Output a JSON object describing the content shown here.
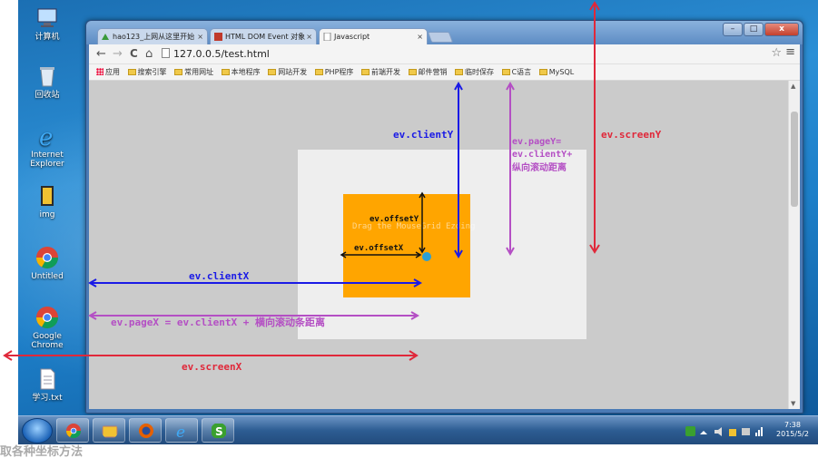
{
  "desktop": {
    "icons": [
      {
        "label": "计算机",
        "icon": "computer-icon"
      },
      {
        "label": "回收站",
        "icon": "recycle-bin-icon"
      },
      {
        "label": "Internet Explorer",
        "icon": "internet-explorer-icon"
      },
      {
        "label": "img",
        "icon": "folder-icon"
      },
      {
        "label": "Untitled",
        "icon": "chrome-icon"
      },
      {
        "label": "Google Chrome",
        "icon": "chrome-icon"
      },
      {
        "label": "学习.txt",
        "icon": "text-file-icon"
      }
    ]
  },
  "browser": {
    "tabs": [
      {
        "label": "hao123_上网从这里开始",
        "icon": "hao123-icon"
      },
      {
        "label": "HTML DOM Event 对象",
        "icon": "w3school-icon"
      },
      {
        "label": "Javascript",
        "icon": "page-icon"
      }
    ],
    "tab_close": "×",
    "nav": {
      "back": "←",
      "forward": "→",
      "reload": "C",
      "home": "⌂"
    },
    "url": "127.0.0.5/test.html",
    "star": "☆",
    "menu": "≡",
    "window_controls": {
      "minimize": "–",
      "maximize": "□",
      "close": "x"
    },
    "bookmarks": [
      "应用",
      "搜索引擎",
      "常用网址",
      "本地程序",
      "网站开发",
      "PHP程序",
      "前端开发",
      "邮件营销",
      "临时保存",
      "C语言",
      "MySQL"
    ],
    "page": {
      "faint_text": "Drag the MouseGrid Ezding"
    }
  },
  "annotations": {
    "client_y": "ev.clientY",
    "page_y_1": "ev.pageY=",
    "page_y_2": "ev.clientY+",
    "page_y_3": "纵向滚动距离",
    "screen_y": "ev.screenY",
    "offset_y": "ev.offsetY",
    "offset_x": "ev.offsetX",
    "client_x": "ev.clientX",
    "page_x": "ev.pageX = ev.clientX + 横向滚动条距离",
    "screen_x": "ev.screenX"
  },
  "taskbar": {
    "items": [
      "chrome-icon",
      "file-explorer-icon",
      "firefox-icon",
      "internet-explorer-icon",
      "sogou-icon"
    ],
    "clock_time": "7:38",
    "clock_date": "2015/5/2"
  },
  "caption": "取各种坐标方法",
  "colors": {
    "client": "#1a1ae6",
    "page": "#b44fc4",
    "screen": "#e0283a",
    "offset": "#111111",
    "orange_box": "#ffa500",
    "dot": "#2a9fd6"
  }
}
